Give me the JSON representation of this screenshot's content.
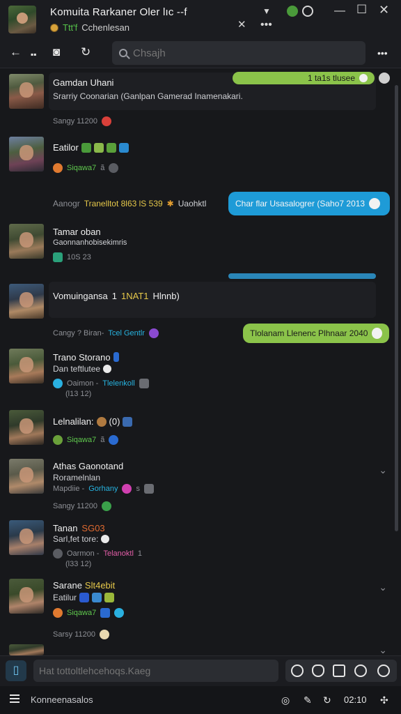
{
  "window": {
    "title": "Komuita Rarkaner Oler lıc ‑‑f",
    "sub_icon_text": "Ttt'f",
    "sub_text": "Cchenlesan"
  },
  "toolbar": {
    "search_placeholder": "Chsajh"
  },
  "messages": [
    {
      "name": "Gamdan Uhani",
      "line": "Srarriy Coonarian (Ganlpan Gamerad Inamenakari.",
      "meta": "Sangy 11200",
      "meta_chip_color": "#d9403a",
      "bubble": {
        "text": "1 ta1s tlusee",
        "color": "#8bc34a"
      }
    },
    {
      "name": "Eatilor",
      "meta_green": "Siqawa7",
      "meta_extra": "ã"
    },
    {
      "system": "Aanogr",
      "system_yellow": "Tranelltot 8l63 lS 539",
      "system_tail": "Uaohktl",
      "bubble": {
        "text": "Char flar Usasalogrer (Saho7 2013",
        "color": "#1e9bd7"
      }
    },
    {
      "name": "Tamar oban",
      "line": "Gaonnanhobisekimris",
      "meta": "10S 23"
    },
    {
      "name": "Vomuingansa",
      "name_tail": "1",
      "name_tag": "1NAT1",
      "name_suffix": "Hlnnb)"
    },
    {
      "system": "Cangy ? Biran-",
      "system_cyan": "Tcel Gentlr",
      "bubble": {
        "text": "Tlolanam Llenenc Plhnaar 2040",
        "color": "#8bc34a"
      }
    },
    {
      "name": "Trano Storano",
      "line": "Dan teftlutee",
      "meta": "Oaimon -",
      "meta_cyan": "Tlelenkoll",
      "meta_sub": "(l13 12)"
    },
    {
      "name": "Lelnalilan:",
      "name_tail": "(0)",
      "meta_green": "Siqawa7",
      "meta_extra": "ã"
    },
    {
      "name": "Athas Gaonotand",
      "line": "Roramelnlan",
      "meta": "Mapdiie -",
      "meta_cyan": "Gorhany",
      "meta_extra": "s",
      "meta2": "Sangy 11200"
    },
    {
      "name": "Tanan",
      "name_tag": "SG03",
      "line": "Sarl,fet tore:",
      "meta": "Oarmon -",
      "meta_pink": "Telanoktl",
      "meta_extra": "1",
      "meta_sub": "(l33 12)"
    },
    {
      "name": "Sarane",
      "name_tag": "Slt4ebit",
      "line": "Eatilur",
      "meta_green": "Siqawa7",
      "meta2": "Sarsy 11200"
    }
  ],
  "composer": {
    "placeholder": "Hat tottoltlehcehoqs.Kaeg"
  },
  "statusbar": {
    "label": "Konneenasalos",
    "time": "02:10"
  },
  "colors": {
    "accent_green": "#8bc34a",
    "accent_blue": "#1e9bd7",
    "background": "#17181b"
  }
}
